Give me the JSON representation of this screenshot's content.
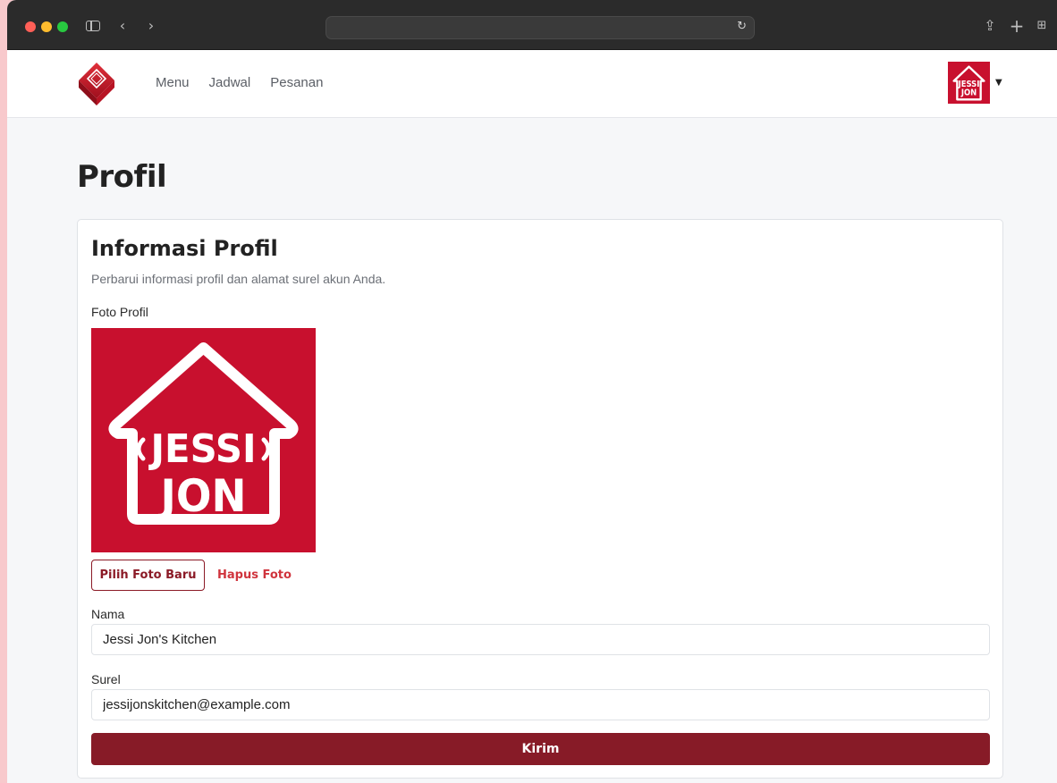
{
  "browser": {
    "back_glyph": "‹",
    "forward_glyph": "›",
    "reload_glyph": "↻",
    "share_glyph": "⇪",
    "new_tab_glyph": "+",
    "tabs_glyph": "⊞"
  },
  "navbar": {
    "links": [
      "Menu",
      "Jadwal",
      "Pesanan"
    ],
    "user_menu_caret": "▼"
  },
  "logo": {
    "line1": "JESSI",
    "line2": "JON"
  },
  "page": {
    "title": "Profil"
  },
  "profile_form": {
    "title": "Informasi Profil",
    "description": "Perbarui informasi profil dan alamat surel akun Anda.",
    "photo_label": "Foto Profil",
    "choose_photo_label": "Pilih Foto Baru",
    "remove_photo_label": "Hapus Foto",
    "name_label": "Nama",
    "name_value": "Jessi Jon's Kitchen",
    "email_label": "Surel",
    "email_value": "jessijonskitchen@example.com",
    "submit_label": "Kirim"
  },
  "colors": {
    "brand_red": "#c8102e",
    "primary_button": "#871b27",
    "danger_link": "#d0343d"
  }
}
